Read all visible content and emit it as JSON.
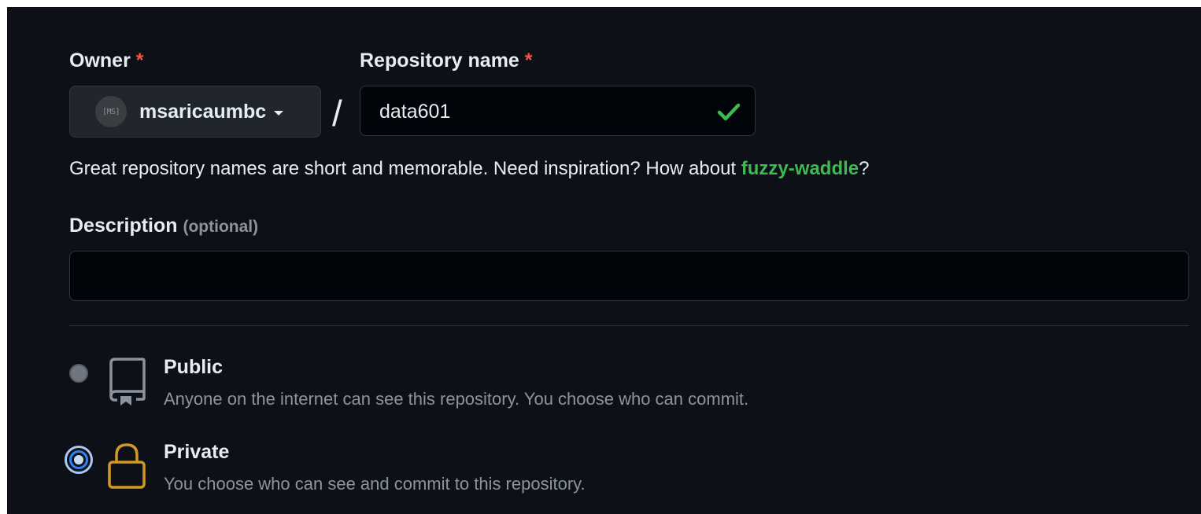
{
  "owner": {
    "label": "Owner",
    "required_mark": "*",
    "avatar_text": "[MS]",
    "selected": "msaricaumbc"
  },
  "repo": {
    "label": "Repository name",
    "required_mark": "*",
    "value": "data601",
    "status_icon": "check-icon"
  },
  "separator": "/",
  "hint": {
    "prefix": "Great repository names are short and memorable. Need inspiration? How about ",
    "suggestion": "fuzzy-waddle",
    "suffix": "?"
  },
  "description": {
    "label": "Description",
    "optional": "(optional)",
    "value": ""
  },
  "visibility": {
    "options": [
      {
        "title": "Public",
        "description": "Anyone on the internet can see this repository. You choose who can commit.",
        "icon": "repo-book-icon",
        "selected": false
      },
      {
        "title": "Private",
        "description": "You choose who can see and commit to this repository.",
        "icon": "lock-icon",
        "selected": true
      }
    ]
  },
  "colors": {
    "background": "#0d1117",
    "required": "#f85149",
    "success": "#3fb950",
    "lock": "#d29922"
  }
}
